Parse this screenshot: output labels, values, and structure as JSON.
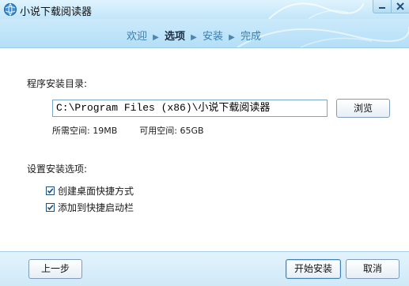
{
  "window": {
    "title": "小说下载阅读器"
  },
  "steps": [
    {
      "label": "欢迎",
      "active": false
    },
    {
      "label": "选项",
      "active": true
    },
    {
      "label": "安装",
      "active": false
    },
    {
      "label": "完成",
      "active": false
    }
  ],
  "install_dir": {
    "label": "程序安装目录:",
    "value": "C:\\Program Files (x86)\\小说下载阅读器",
    "browse_label": "浏览",
    "required_space": "所需空间: 19MB",
    "available_space": "可用空间: 65GB"
  },
  "options": {
    "label": "设置安装选项:",
    "items": [
      {
        "label": "创建桌面快捷方式",
        "checked": true
      },
      {
        "label": "添加到快捷启动栏",
        "checked": true
      }
    ]
  },
  "footer": {
    "back_label": "上一步",
    "install_label": "开始安装",
    "cancel_label": "取消"
  },
  "colors": {
    "header": "#b4dff7",
    "step_active": "#1c2f45",
    "step_inactive": "#3a7fb0"
  },
  "icons": {
    "app": "globe-icon",
    "minimize": "minimize-icon",
    "close": "close-icon",
    "step_separator": "chevron-right-icon",
    "checkbox": "checkmark-icon"
  }
}
